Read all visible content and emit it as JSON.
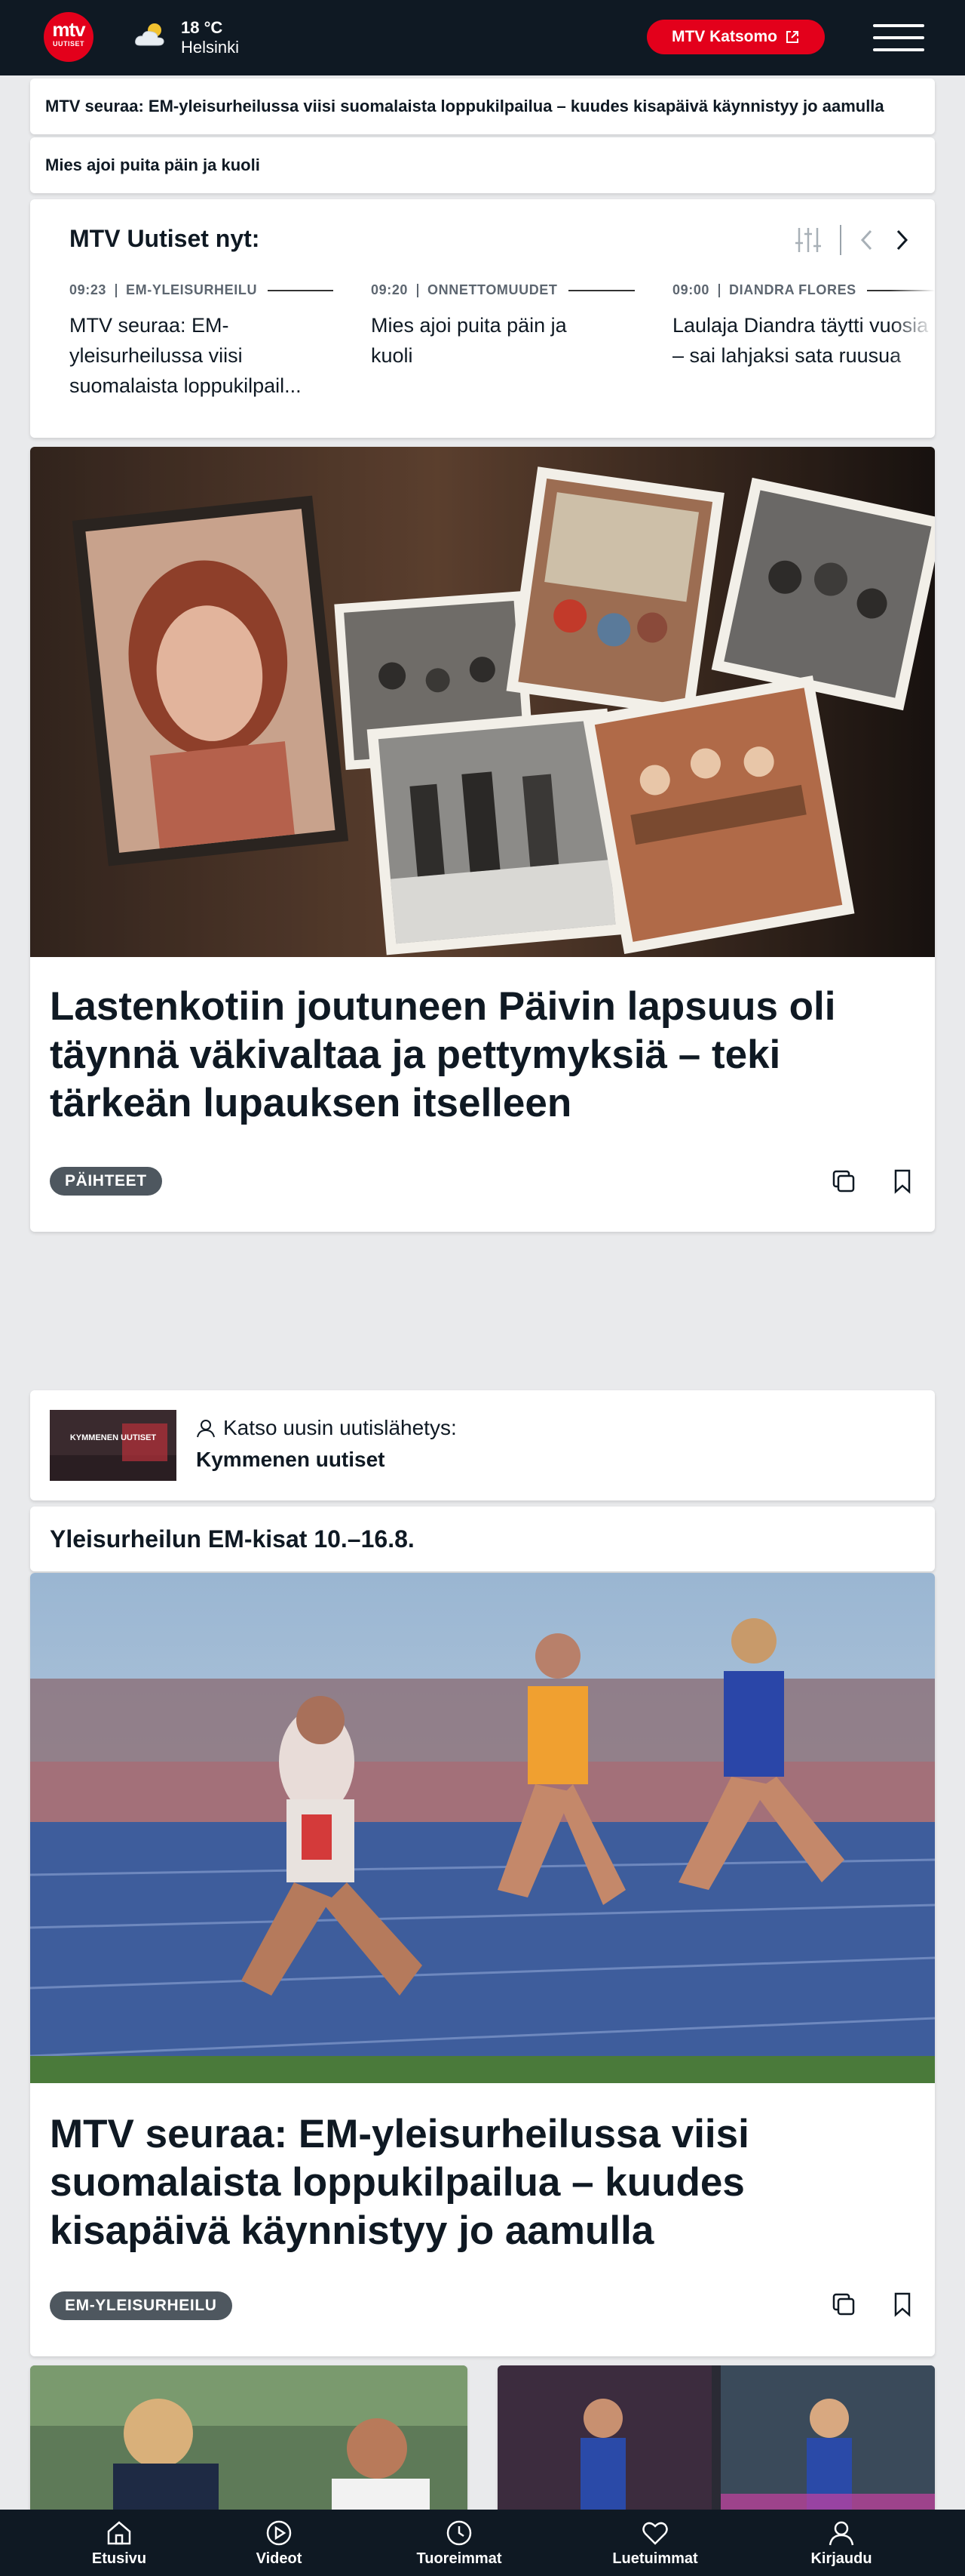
{
  "header": {
    "logo_main": "mtv",
    "logo_sub": "UUTISET",
    "weather": {
      "icon": "partly-cloudy-icon",
      "temp": "18 °C",
      "city": "Helsinki"
    },
    "katsomo_label": "MTV Katsomo",
    "menu_icon": "hamburger-menu-icon"
  },
  "breaking": [
    {
      "text": "MTV seuraa: EM-yleisurheilussa viisi suomalaista loppukilpailua – kuudes kisapäivä käynnistyy jo aamulla"
    },
    {
      "text": "Mies ajoi puita päin ja kuoli"
    }
  ],
  "ticker": {
    "title": "MTV Uutiset nyt:",
    "items": [
      {
        "time": "09:23",
        "category": "EM-YLEISURHEILU",
        "headline": "MTV seuraa: EM-yleisurheilussa viisi suomalaista loppukilpail..."
      },
      {
        "time": "09:20",
        "category": "ONNETTOMUUDET",
        "headline": "Mies ajoi puita päin ja kuoli"
      },
      {
        "time": "09:00",
        "category": "DIANDRA FLORES",
        "headline": "Laulaja Diandra täytti vuosia – sai lahjaksi sata ruusua"
      }
    ]
  },
  "articles": [
    {
      "title": "Lastenkotiin joutuneen Päivin lapsuus oli täynnä väkivaltaa ja pettymyksiä – teki tärkeän lupauksen itselleen",
      "tag": "PÄIHTEET"
    },
    {
      "title": "MTV seuraa: EM-yleisurheilussa viisi suomalaista loppukilpailua – kuudes kisapäivä käynnistyy jo aamulla",
      "tag": "EM-YLEISURHEILU"
    }
  ],
  "broadcast": {
    "label": "Katso uusin uutislähetys:",
    "title": "Kymmenen uutiset",
    "thumb_text": "KYMMENEN UUTISET"
  },
  "section": {
    "title": "Yleisurheilun EM-kisat 10.–16.8."
  },
  "bottom_nav": [
    {
      "label": "Etusivu",
      "icon": "home-icon"
    },
    {
      "label": "Videot",
      "icon": "play-icon"
    },
    {
      "label": "Tuoreimmat",
      "icon": "clock-icon"
    },
    {
      "label": "Luetuimmat",
      "icon": "heart-icon"
    },
    {
      "label": "Kirjaudu",
      "icon": "user-icon"
    }
  ],
  "colors": {
    "brand_red": "#e3001b",
    "header_bg": "#0f1923",
    "tag_bg": "#4e575f"
  }
}
